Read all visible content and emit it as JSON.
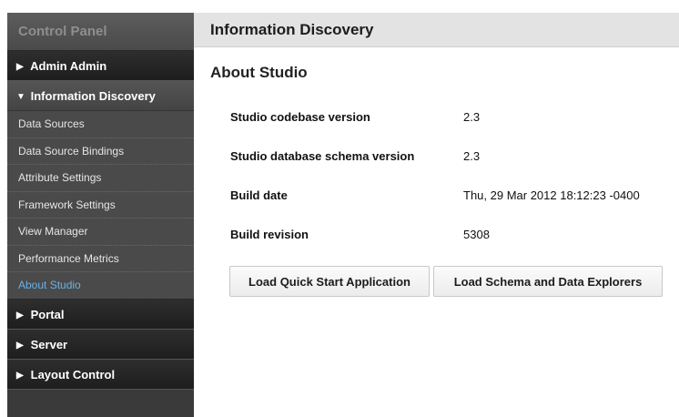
{
  "sidebar": {
    "title": "Control Panel",
    "sections": [
      {
        "label": "Admin Admin",
        "arrow": "▶"
      },
      {
        "label": "Information Discovery",
        "arrow": "▼",
        "items": [
          "Data Sources",
          "Data Source Bindings",
          "Attribute Settings",
          "Framework Settings",
          "View Manager",
          "Performance Metrics",
          "About Studio"
        ],
        "active_item": "About Studio"
      },
      {
        "label": "Portal",
        "arrow": "▶"
      },
      {
        "label": "Server",
        "arrow": "▶"
      },
      {
        "label": "Layout Control",
        "arrow": "▶"
      }
    ]
  },
  "header": {
    "title": "Information Discovery"
  },
  "main": {
    "title": "About Studio",
    "info": [
      {
        "label": "Studio codebase version",
        "value": "2.3"
      },
      {
        "label": "Studio database schema version",
        "value": "2.3"
      },
      {
        "label": "Build date",
        "value": "Thu, 29 Mar 2012 18:12:23 -0400"
      },
      {
        "label": "Build revision",
        "value": "5308"
      }
    ],
    "buttons": {
      "quick_start": "Load Quick Start Application",
      "schema_explorers": "Load Schema and Data Explorers"
    }
  },
  "colors": {
    "active_link": "#66b2e8",
    "sidebar_bg": "#3a3a3a",
    "header_bg": "#e3e3e3"
  }
}
